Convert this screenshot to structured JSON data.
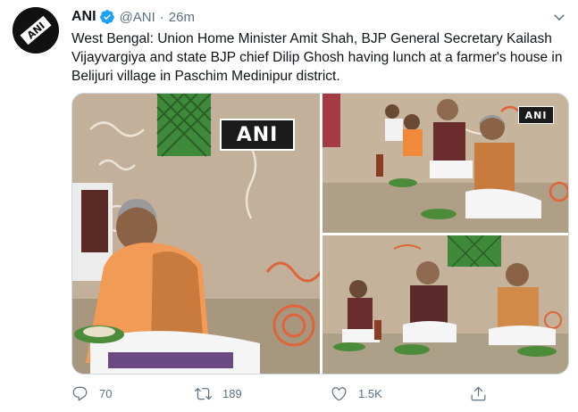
{
  "tweet": {
    "display_name": "ANI",
    "handle": "@ANI",
    "separator": "·",
    "time": "26m",
    "text": "West Bengal: Union Home Minister Amit Shah, BJP General Secretary Kailash Vijayvargiya and state BJP chief Dilip Ghosh having lunch at a farmer's house in Belijuri village in Paschim Medinipur district.",
    "avatar_logo_text": "ANI",
    "verified_icon": "verified-badge-icon",
    "menu_icon": "chevron-down-icon"
  },
  "media": {
    "photo_count": 3,
    "watermark_left": "ANI",
    "watermark_top_right": "ANI"
  },
  "actions": {
    "reply_count": "70",
    "retweet_count": "189",
    "like_count": "1.5K",
    "reply_icon": "reply-icon",
    "retweet_icon": "retweet-icon",
    "like_icon": "heart-icon",
    "share_icon": "share-icon"
  },
  "colors": {
    "accent": "#1da1f2",
    "text_primary": "#0f1419",
    "text_secondary": "#5b7083",
    "border": "#cfd9de"
  }
}
